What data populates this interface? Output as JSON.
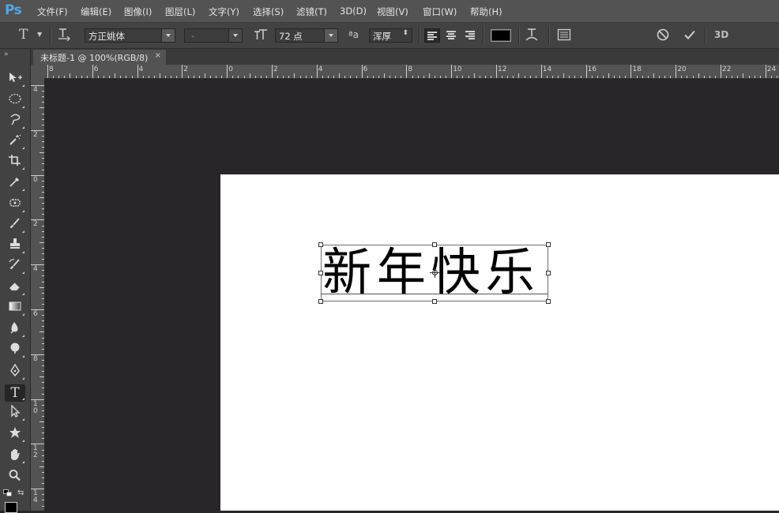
{
  "app": {
    "logo": "Ps"
  },
  "menu": [
    "文件(F)",
    "编辑(E)",
    "图像(I)",
    "图层(L)",
    "文字(Y)",
    "选择(S)",
    "滤镜(T)",
    "3D(D)",
    "视图(V)",
    "窗口(W)",
    "帮助(H)"
  ],
  "options": {
    "font_family": "方正姚体",
    "font_style": "-",
    "font_size": "72 点",
    "aa_label": "ªa",
    "antialias": "浑厚",
    "text_color": "#000000",
    "threed_label": "3D"
  },
  "document": {
    "tab_title": "未标题-1 @ 100%(RGB/8)",
    "close": "×"
  },
  "canvas_text": "新年快乐",
  "ruler_top_labels": [
    "8",
    "6",
    "4",
    "2",
    "0",
    "2",
    "4",
    "6",
    "8",
    "10",
    "12",
    "14",
    "16",
    "18",
    "20",
    "22",
    "24"
  ],
  "ruler_left_labels": [
    "4",
    "2",
    "0",
    "2",
    "4",
    "6",
    "8",
    "10",
    "12",
    "14"
  ],
  "tools": [
    "move-tool",
    "marquee-tool",
    "lasso-tool",
    "magic-wand-tool",
    "crop-tool",
    "eyedropper-tool",
    "healing-brush-tool",
    "brush-tool",
    "clone-stamp-tool",
    "history-brush-tool",
    "eraser-tool",
    "gradient-tool",
    "blur-tool",
    "dodge-tool",
    "pen-tool",
    "type-tool",
    "path-selection-tool",
    "custom-shape-tool",
    "hand-tool",
    "zoom-tool"
  ]
}
